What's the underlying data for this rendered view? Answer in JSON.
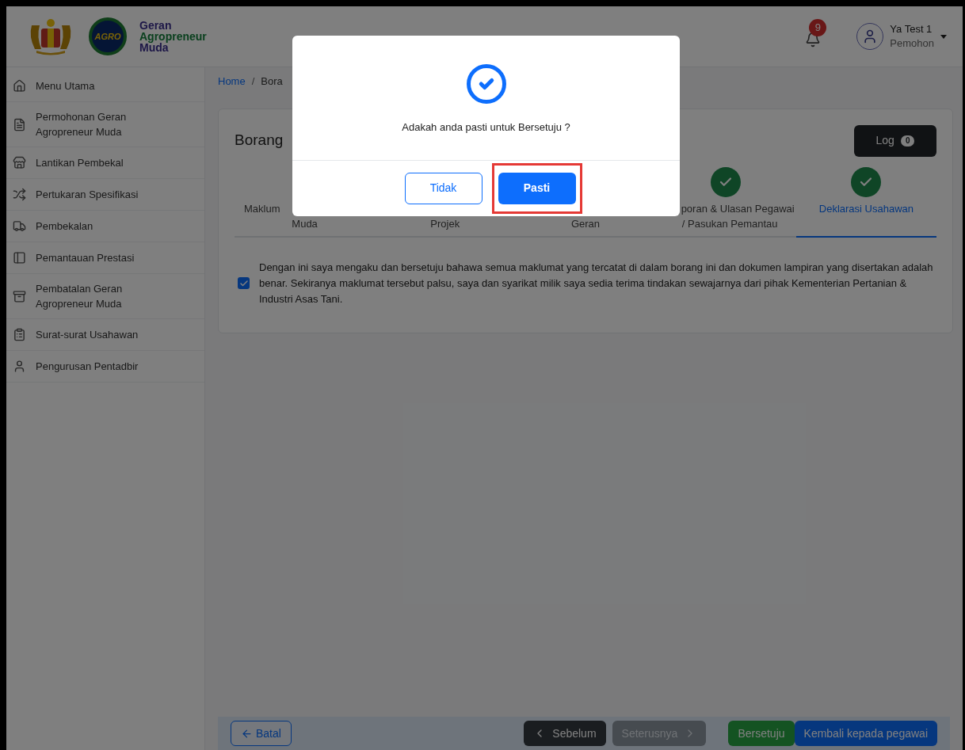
{
  "header": {
    "logo_text": "AGRO",
    "app_name": [
      "Geran",
      "Agropreneur",
      "Muda"
    ],
    "notifications": {
      "count": "9"
    },
    "user": {
      "name": "Ya Test 1",
      "role": "Pemohon"
    }
  },
  "sidebar": {
    "items": [
      {
        "kind": "home",
        "label": "Menu Utama"
      },
      {
        "kind": "file",
        "label": "Permohonan Geran Agropreneur Muda"
      },
      {
        "kind": "store",
        "label": "Lantikan Pembekal"
      },
      {
        "kind": "shuffle",
        "label": "Pertukaran Spesifikasi"
      },
      {
        "kind": "truck",
        "label": "Pembekalan"
      },
      {
        "kind": "panel",
        "label": "Pemantauan Prestasi"
      },
      {
        "kind": "archive",
        "label": "Pembatalan Geran Agropreneur Muda"
      },
      {
        "kind": "letter",
        "label": "Surat-surat Usahawan"
      },
      {
        "kind": "user",
        "label": "Pengurusan Pentadbir"
      }
    ]
  },
  "breadcrumb": [
    "Home",
    "/",
    "Bora"
  ],
  "card": {
    "title": "Borang",
    "log_button": {
      "label": "Log",
      "count": "0"
    },
    "steps": [
      {
        "lines": [
          "Maklum",
          "Muda"
        ],
        "selected": false
      },
      {
        "lines": [
          "Projek"
        ],
        "selected": false
      },
      {
        "lines": [
          "Geran"
        ],
        "selected": false
      },
      {
        "lines": [
          "poran & Ulasan Pegawai",
          "/ Pasukan Pemantau"
        ],
        "done": true,
        "selected": false
      },
      {
        "lines": [
          "Deklarasi Usahawan"
        ],
        "done": true,
        "selected": true
      }
    ],
    "declaration": {
      "checked": true,
      "text": "Dengan ini saya mengaku dan bersetuju bahawa semua maklumat yang tercatat di dalam borang ini dan dokumen lampiran yang disertakan adalah benar. Sekiranya maklumat tersebut palsu, saya dan syarikat milik saya sedia terima tindakan sewajarnya dari pihak Kementerian Pertanian & Industri Asas Tani."
    }
  },
  "footer": {
    "cancel": "Batal",
    "buttons": [
      {
        "kind": "dark",
        "label": "Sebelum",
        "disabled": false
      },
      {
        "kind": "gray",
        "label": "Seterusnya",
        "disabled": true
      },
      {
        "kind": "green",
        "label": "Bersetuju",
        "disabled": false
      },
      {
        "kind": "blue",
        "label": "Kembali kepada pegawai",
        "disabled": false
      }
    ]
  },
  "dialog": {
    "message": "Adakah anda pasti untuk Bersetuju ?",
    "buttons": [
      {
        "kind": "outline",
        "label": "Tidak",
        "highlighted": false
      },
      {
        "kind": "primary",
        "label": "Pasti",
        "highlighted": true
      }
    ]
  }
}
